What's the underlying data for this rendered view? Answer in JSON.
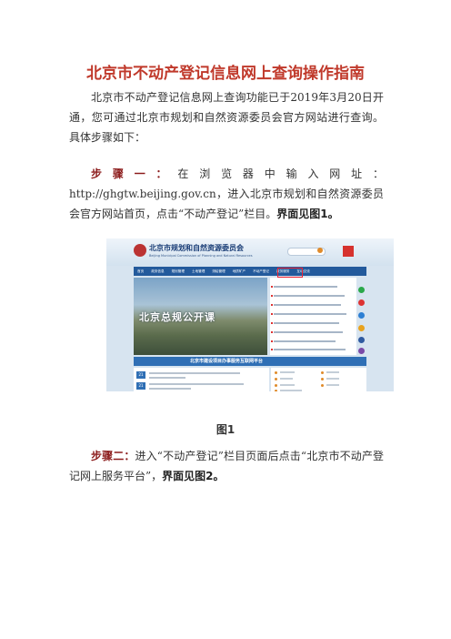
{
  "title": "北京市不动产登记信息网上查询操作指南",
  "intro": "北京市不动产登记信息网上查询功能已于2019年3月20日开通，您可通过北京市规划和自然资源委员会官方网站进行查询。具体步骤如下：",
  "step1": {
    "label": "步骤一：",
    "text": "在浏览器中输入网址：http://ghgtw.beijing.gov.cn，进入北京市规划和自然资源委员会官方网站首页，点击“不动产登记”栏目。",
    "emphasis": "界面见图1。"
  },
  "figure1": {
    "site_name": "北京市规划和自然资源委员会",
    "site_name_en": "Beijing Municipal Commission of Planning and Natural Resources",
    "nav_items": [
      "首页",
      "政务信息",
      "规划管理",
      "土地管理",
      "测绘管理",
      "地质矿产",
      "不动产登记",
      "政务服务",
      "互动交流"
    ],
    "photo_caption": "北京总规公开课",
    "banner": "北京市建设项目办事服务互联网平台",
    "badges": [
      "21",
      "21"
    ],
    "caption": "图1"
  },
  "step2": {
    "label": "步骤二：",
    "text": "进入“不动产登记”栏目页面后点击“北京市不动产登记网上服务平台”，",
    "emphasis": "界面见图2。"
  },
  "colors": {
    "heading": "#c0392b",
    "step": "#8b1a1a",
    "nav": "#235a9c",
    "highlight": "#e23"
  }
}
